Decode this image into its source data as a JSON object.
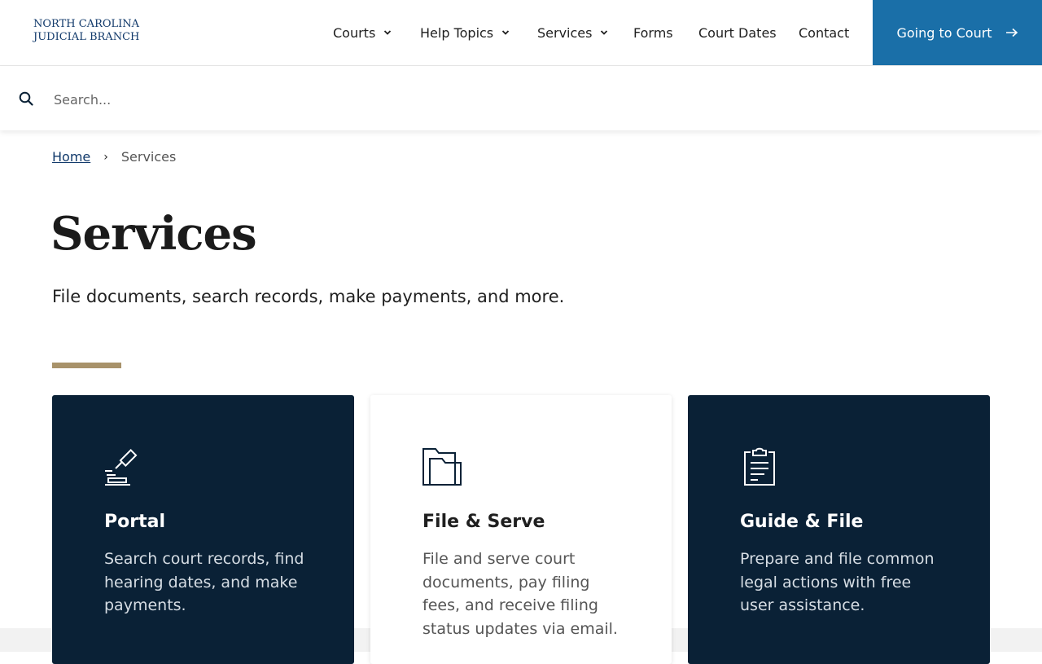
{
  "header": {
    "logo_line1": "NORTH CAROLINA",
    "logo_line2": "JUDICIAL BRANCH",
    "nav": [
      {
        "label": "Courts"
      },
      {
        "label": "Help Topics"
      },
      {
        "label": "Services"
      },
      {
        "label": "Forms"
      },
      {
        "label": "Court Dates"
      },
      {
        "label": "Contact"
      }
    ],
    "cta_label": "Going to Court"
  },
  "search": {
    "placeholder": "Search..."
  },
  "breadcrumb": {
    "home": "Home",
    "current": "Services"
  },
  "page": {
    "title": "Services",
    "subtitle": "File documents, search records, make payments, and more."
  },
  "cards": [
    {
      "title": "Portal",
      "description": "Search court records, find hearing dates, and make payments.",
      "icon": "gavel-icon"
    },
    {
      "title": "File & Serve",
      "description": "File and serve court documents, pay filing fees, and receive filing status updates via email.",
      "icon": "folder-icon"
    },
    {
      "title": "Guide & File",
      "description": "Prepare and file common legal actions with free user assistance.",
      "icon": "clipboard-icon"
    }
  ],
  "colors": {
    "brand_navy": "#0a2136",
    "cta_blue": "#1a6fa8",
    "logo_blue": "#123a6b",
    "accent_gold": "#a8926a"
  }
}
